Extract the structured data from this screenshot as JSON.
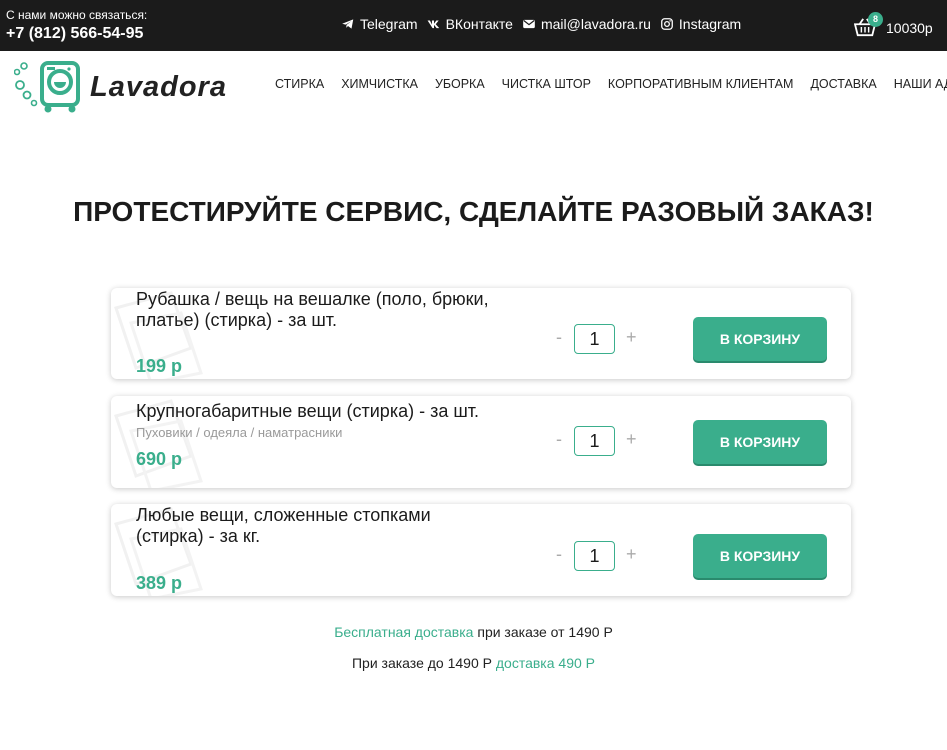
{
  "topbar": {
    "contact_caption": "С нами можно связаться:",
    "phone": "+7 (812) 566-54-95",
    "socials": [
      {
        "icon": "telegram-icon",
        "label": "Telegram"
      },
      {
        "icon": "vk-icon",
        "label": "ВКонтакте"
      },
      {
        "icon": "mail-icon",
        "label": "mail@lavadora.ru"
      },
      {
        "icon": "instagram-icon",
        "label": "Instagram"
      }
    ],
    "cart": {
      "icon": "basket-icon",
      "count": "8",
      "total": "10030р"
    }
  },
  "header": {
    "logo_text": "Lavadora",
    "nav": [
      "СТИРКА",
      "ХИМЧИСТКА",
      "УБОРКА",
      "ЧИСТКА ШТОР",
      "КОРПОРАТИВНЫМ КЛИЕНТАМ",
      "ДОСТАВКА",
      "НАШИ АДРЕСА"
    ]
  },
  "main": {
    "title": "ПРОТЕСТИРУЙТЕ СЕРВИС, СДЕЛАЙТЕ РАЗОВЫЙ ЗАКАЗ!",
    "products": [
      {
        "title": "Рубашка / вещь на вешалке (поло, брюки, платье) (стирка) - за шт.",
        "subtitle": "",
        "price": "199 р",
        "qty": "1",
        "minus": "-",
        "plus": "+",
        "button": "В КОРЗИНУ"
      },
      {
        "title": "Крупногабаритные вещи (стирка) - за шт.",
        "subtitle": "Пуховики / одеяла / наматрасники",
        "price": "690 р",
        "qty": "1",
        "minus": "-",
        "plus": "+",
        "button": "В КОРЗИНУ"
      },
      {
        "title": "Любые вещи, сложенные стопками (стирка) - за кг.",
        "subtitle": "",
        "price": "389 р",
        "qty": "1",
        "minus": "-",
        "plus": "+",
        "button": "В КОРЗИНУ"
      }
    ],
    "delivery_note_1": {
      "link": "Бесплатная доставка",
      "text": " при заказе от 1490 Р"
    },
    "delivery_note_2": {
      "text": "При заказе до 1490 Р ",
      "link": "доставка 490 Р"
    }
  },
  "colors": {
    "accent": "#3aae8c",
    "topbar": "#1b1b1b"
  }
}
